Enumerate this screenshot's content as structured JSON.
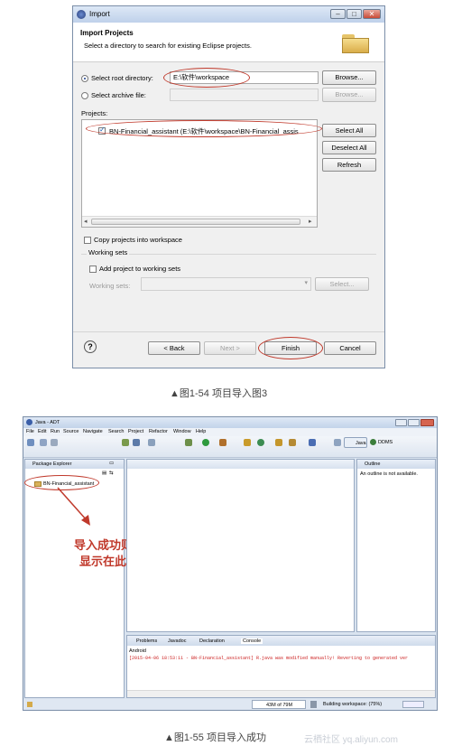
{
  "dialog": {
    "title": "Import",
    "header_title": "Import Projects",
    "header_desc": "Select a directory to search for existing Eclipse projects.",
    "select_root_label": "Select root directory:",
    "root_value": "E:\\软件\\workspace",
    "browse_label": "Browse...",
    "select_archive_label": "Select archive file:",
    "browse2_label": "Browse...",
    "projects_label": "Projects:",
    "project_item": "BN-Financial_assistant (E:\\软件\\workspace\\BN-Financial_assis",
    "select_all": "Select All",
    "deselect_all": "Deselect All",
    "refresh": "Refresh",
    "copy_label": "Copy projects into workspace",
    "working_sets_title": "Working sets",
    "add_ws_label": "Add project to working sets",
    "ws_label": "Working sets:",
    "select_btn": "Select...",
    "help_icon": "?",
    "back": "< Back",
    "next": "Next >",
    "finish": "Finish",
    "cancel": "Cancel"
  },
  "caption1": "▲图1-54 项目导入图3",
  "ide": {
    "title": "Java - ADT",
    "menu": [
      "File",
      "Edit",
      "Run",
      "Source",
      "Navigate",
      "Search",
      "Project",
      "Refactor",
      "Window",
      "Help"
    ],
    "perspective_java": "Java",
    "perspective_ddms": "DDMS",
    "pkg_tab": "Package Explorer",
    "project_name": "BN-Financial_assistant",
    "annotation_line1": "导入成功则",
    "annotation_line2": "显示在此",
    "outline_tab": "Outline",
    "outline_msg": "An outline is not available.",
    "bottom_tabs": [
      "Problems",
      "Javadoc",
      "Declaration",
      "Console"
    ],
    "console_header": "Android",
    "console_line": "[2015-04-06 18:53:11 - BN-Financial_assistant] R.java was modified manually! Reverting to generated ver",
    "memory": "43M of 79M",
    "status_build": "Building workspace: (75%)"
  },
  "caption2": "▲图1-55 项目导入成功",
  "watermark": "云栖社区 yq.aliyun.com",
  "colors": {
    "annotation": "#c0392b",
    "titlebar": "#c9daf0",
    "console_text": "#cc2020"
  }
}
